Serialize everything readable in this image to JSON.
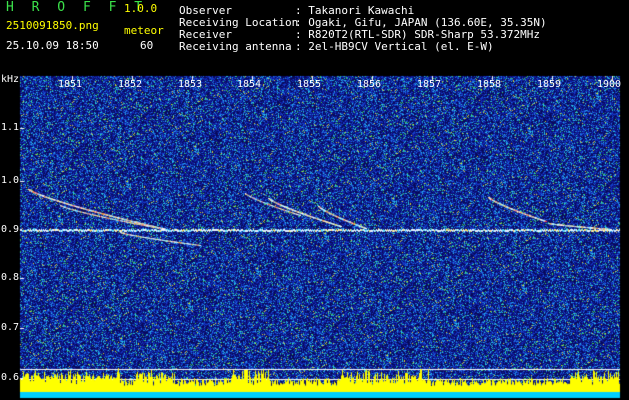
{
  "app": {
    "name": "H R O F F T",
    "version": "1.0.0"
  },
  "file": {
    "name": "2510091850.png",
    "datetime": "25.10.09 18:50"
  },
  "meteor": {
    "label": "meteor",
    "count": "60"
  },
  "info": [
    {
      "key": "Observer",
      "value": ": Takanori Kawachi"
    },
    {
      "key": "Receiving Location",
      "value": ": Ogaki, Gifu, JAPAN (136.60E, 35.35N)"
    },
    {
      "key": "Receiver",
      "value": ": R820T2(RTL-SDR) SDR-Sharp 53.372MHz"
    },
    {
      "key": "Receiving antenna",
      "value": ": 2el-HB9CV Vertical (el. E-W)"
    }
  ],
  "axis": {
    "unit": "kHz",
    "x_ticks": [
      "1851",
      "1852",
      "1853",
      "1854",
      "1855",
      "1856",
      "1857",
      "1858",
      "1859",
      "1900"
    ],
    "y_ticks": [
      "1.1",
      "1.0",
      "0.9",
      "0.8",
      "0.7",
      "0.6"
    ]
  },
  "colors": {
    "logo": "#3be24a",
    "version": "#ffff00",
    "info_text": "#ffffff",
    "background": "#000000",
    "carrier": "#ffffff",
    "level_bar": "#ffff00",
    "baseline": "#00d0ff"
  }
}
